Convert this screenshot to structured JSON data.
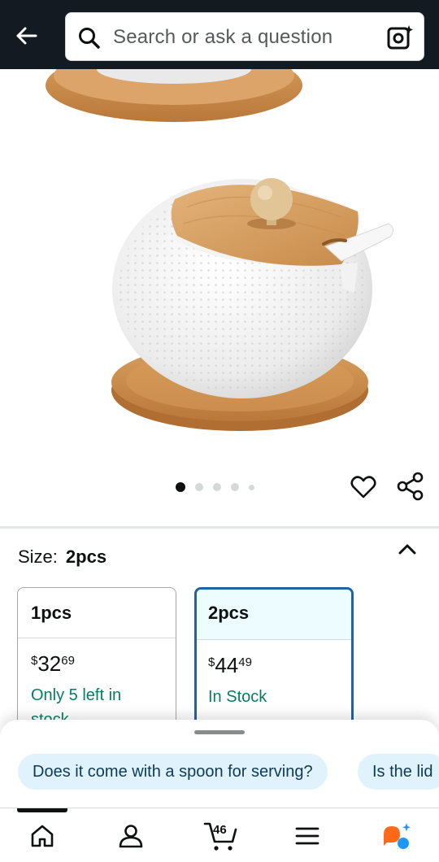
{
  "header": {
    "search_placeholder": "Search or ask a question"
  },
  "gallery": {
    "image_count": 5,
    "active_index": 0
  },
  "size": {
    "label": "Size:",
    "selected": "2pcs",
    "options": [
      {
        "name": "1pcs",
        "currency": "$",
        "whole": "32",
        "fraction": "69",
        "availability": "Only 5 left in stock"
      },
      {
        "name": "2pcs",
        "currency": "$",
        "whole": "44",
        "fraction": "49",
        "availability": "In Stock"
      }
    ]
  },
  "questions": [
    "Does it come with a spoon for serving?",
    "Is the lid"
  ],
  "nav": {
    "cart_count": "46"
  },
  "colors": {
    "header_bg": "#131a22",
    "selected_border": "#2162a1",
    "stock_green": "#067d62",
    "chip_bg": "#e0f2fb",
    "rufus_orange": "#ff6a1a",
    "rufus_blue": "#1a98ff"
  }
}
